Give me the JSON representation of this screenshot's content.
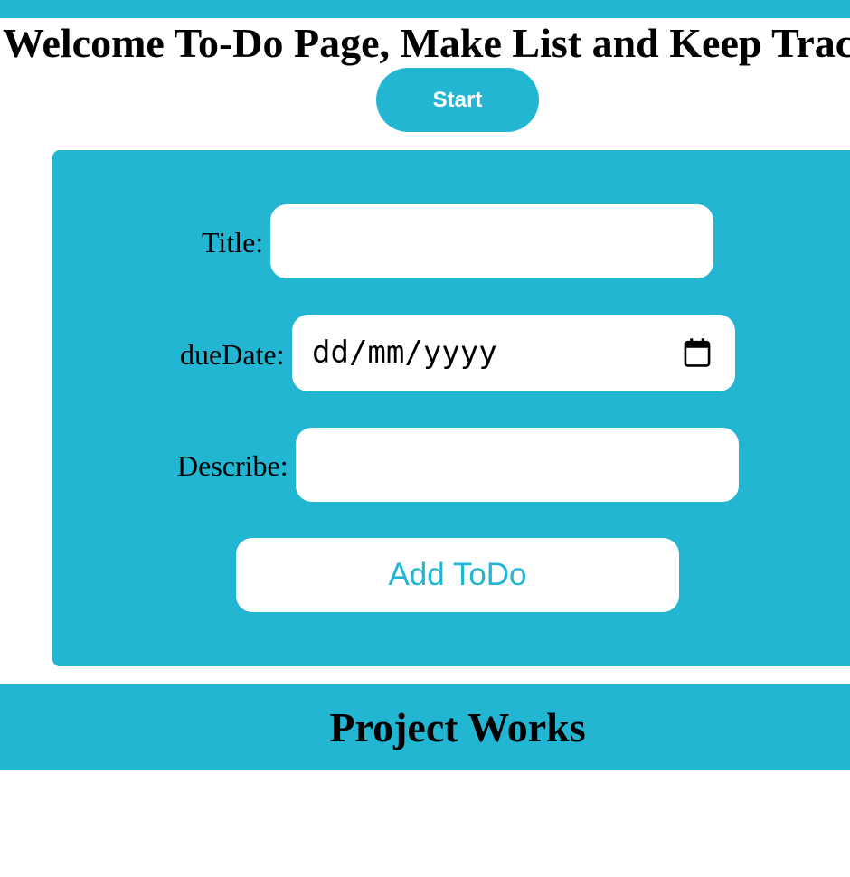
{
  "header": {
    "title": "Welcome To-Do Page, Make List and Keep Track",
    "start_label": "Start"
  },
  "form": {
    "title_label": "Title:",
    "title_value": "",
    "due_date_label": "dueDate:",
    "due_date_placeholder": "dd/mm/yyyy",
    "describe_label": "Describe:",
    "describe_value": "",
    "add_label": "Add ToDo"
  },
  "footer": {
    "title": "Project Works"
  },
  "icons": {
    "calendar": "calendar-icon"
  },
  "colors": {
    "accent": "#22b6d2",
    "surface": "#ffffff",
    "text": "#000000"
  }
}
